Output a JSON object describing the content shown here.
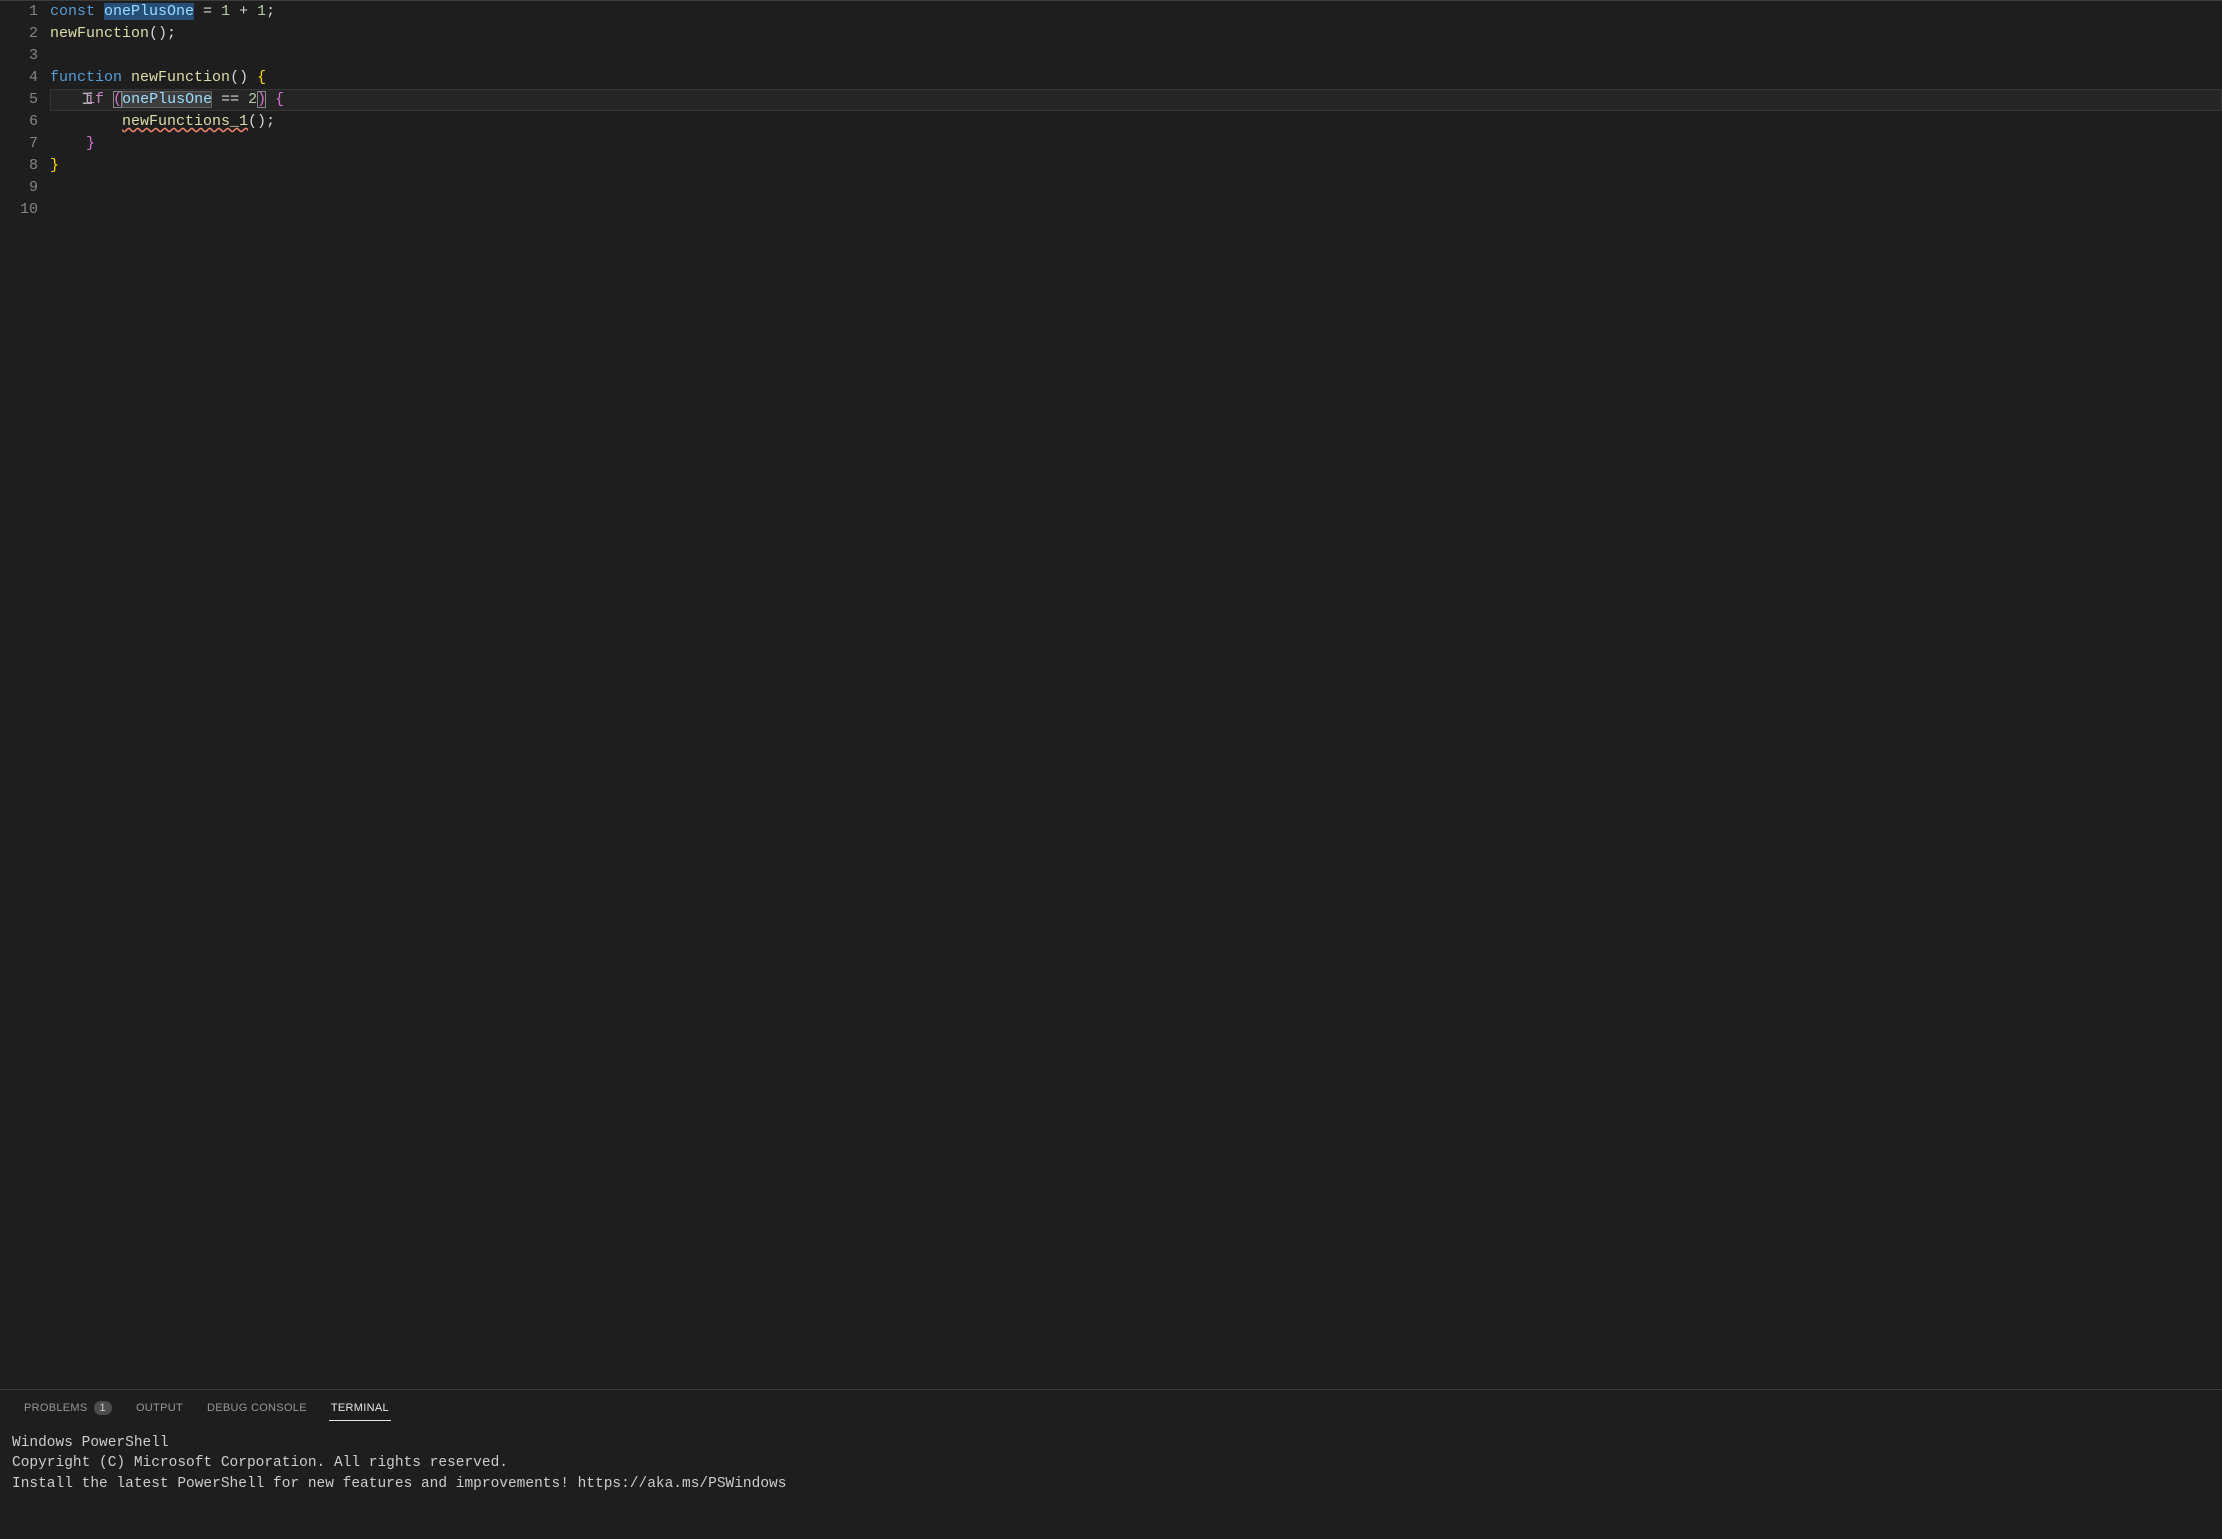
{
  "editor": {
    "lines": [
      {
        "num": "1"
      },
      {
        "num": "2"
      },
      {
        "num": "3"
      },
      {
        "num": "4"
      },
      {
        "num": "5"
      },
      {
        "num": "6"
      },
      {
        "num": "7"
      },
      {
        "num": "8"
      },
      {
        "num": "9"
      },
      {
        "num": "10"
      }
    ],
    "code": {
      "line1": {
        "const": "const",
        "varName": "onePlusOne",
        "equals": " = ",
        "one1": "1",
        "plus": " + ",
        "one2": "1",
        "semi": ";"
      },
      "line2": {
        "funcCall": "newFunction",
        "parens": "()",
        "semi": ";"
      },
      "line4": {
        "function": "function",
        "space": " ",
        "funcName": "newFunction",
        "parens": "()",
        "space2": " ",
        "brace": "{"
      },
      "line5": {
        "indent": "    ",
        "if": "if",
        "space": " ",
        "openParen": "(",
        "varName": "onePlusOne",
        "op": " == ",
        "two": "2",
        "closeParen": ")",
        "space2": " ",
        "brace": "{"
      },
      "line6": {
        "indent": "        ",
        "funcCall": "newFunctions_1",
        "parens": "()",
        "semi": ";"
      },
      "line7": {
        "indent": "    ",
        "brace": "}"
      },
      "line8": {
        "brace": "}"
      }
    },
    "activeLineIndex": 4
  },
  "panel": {
    "tabs": {
      "problems": "PROBLEMS",
      "problemsCount": "1",
      "output": "OUTPUT",
      "debugConsole": "DEBUG CONSOLE",
      "terminal": "TERMINAL"
    },
    "terminal": {
      "line1": "Windows PowerShell",
      "line2": "Copyright (C) Microsoft Corporation. All rights reserved.",
      "line3": "",
      "line4": "Install the latest PowerShell for new features and improvements! https://aka.ms/PSWindows"
    }
  }
}
